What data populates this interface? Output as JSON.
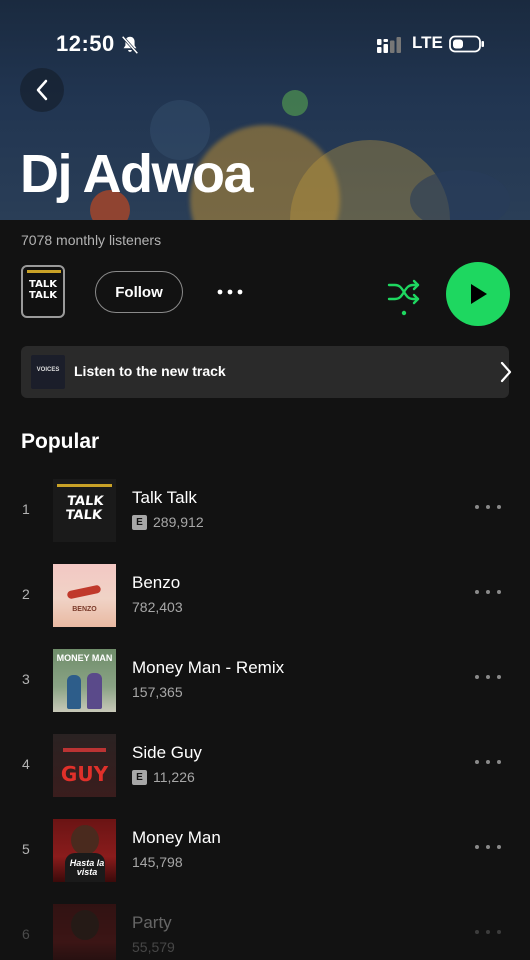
{
  "status": {
    "time": "12:50",
    "network": "LTE"
  },
  "artist": {
    "name": "Dj Adwoa",
    "monthly_listeners": "7078 monthly listeners"
  },
  "controls": {
    "cover_text_line1": "TALK",
    "cover_text_line2": "TALK",
    "follow_label": "Follow"
  },
  "promo": {
    "text": "Listen to the new track",
    "thumb_text": "VOICES"
  },
  "popular": {
    "title": "Popular",
    "tracks": [
      {
        "rank": "1",
        "title": "Talk Talk",
        "plays": "289,912",
        "explicit": true,
        "art_text": "TALK TALK"
      },
      {
        "rank": "2",
        "title": "Benzo",
        "plays": "782,403",
        "explicit": false,
        "art_text": "BENZO"
      },
      {
        "rank": "3",
        "title": "Money Man - Remix",
        "plays": "157,365",
        "explicit": false,
        "art_text": "MONEY MAN"
      },
      {
        "rank": "4",
        "title": "Side Guy",
        "plays": "11,226",
        "explicit": true,
        "art_text": "GUY"
      },
      {
        "rank": "5",
        "title": "Money Man",
        "plays": "145,798",
        "explicit": false,
        "art_text": "Hasta la vista"
      },
      {
        "rank": "6",
        "title": "Party",
        "plays": "55,579",
        "explicit": false,
        "art_text": ""
      }
    ],
    "explicit_label": "E"
  },
  "colors": {
    "accent": "#1ed760",
    "background": "#121212",
    "secondary_text": "#b3b3b3"
  },
  "icons": {
    "back": "chevron-left-icon",
    "bell_muted": "bell-slash-icon",
    "signal": "signal-bars-icon",
    "battery": "battery-icon",
    "more": "more-horizontal-icon",
    "shuffle": "shuffle-icon",
    "play": "play-icon",
    "promo_next": "chevron-right-icon"
  }
}
